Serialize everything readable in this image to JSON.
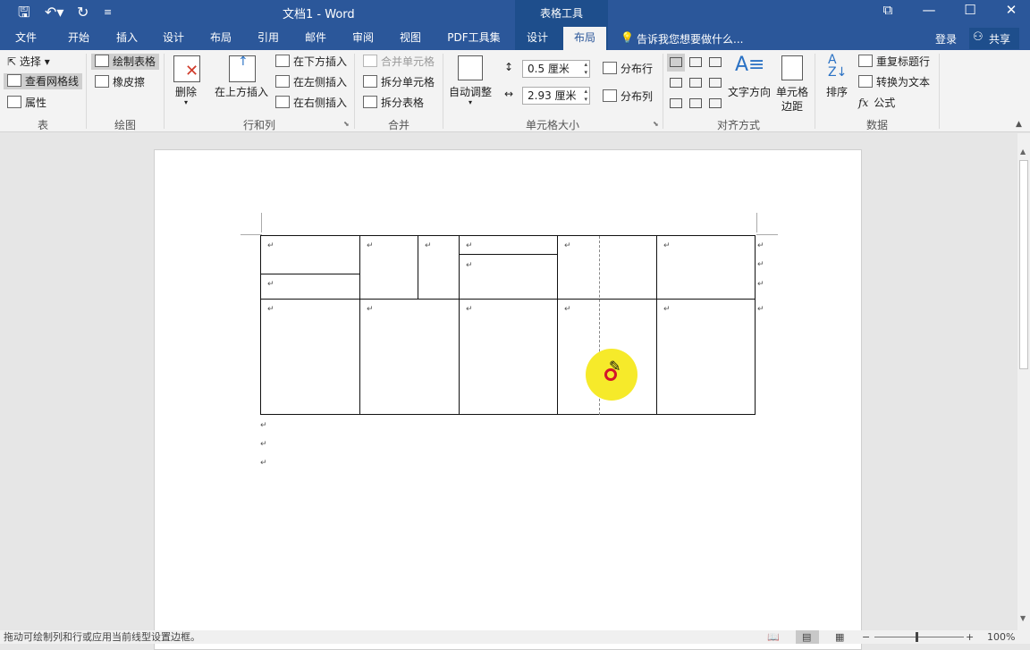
{
  "title_bar": {
    "doc_title": "文档1 - Word",
    "context_group": "表格工具",
    "window_buttons": [
      "restore-ribbon-icon",
      "minimize-icon",
      "maximize-icon",
      "close-icon"
    ]
  },
  "quick_access": {
    "icons": [
      "save-icon",
      "undo-icon",
      "redo-icon",
      "customize-icon"
    ]
  },
  "tabs": [
    "文件",
    "开始",
    "插入",
    "设计",
    "布局",
    "引用",
    "邮件",
    "审阅",
    "视图",
    "PDF工具集",
    "设计",
    "布局"
  ],
  "active_tab": "布局",
  "tell_me": "告诉我您想要做什么...",
  "account": {
    "login": "登录",
    "share": "共享"
  },
  "ribbon": {
    "table": {
      "select": "选择",
      "gridlines": "查看网格线",
      "properties": "属性",
      "label": "表"
    },
    "draw": {
      "draw_table": "绘制表格",
      "eraser": "橡皮擦",
      "label": "绘图"
    },
    "rows_cols": {
      "delete": "删除",
      "insert_above": "在上方插入",
      "insert_below": "在下方插入",
      "insert_left": "在左侧插入",
      "insert_right": "在右侧插入",
      "label": "行和列"
    },
    "merge": {
      "merge_cells": "合并单元格",
      "split_cells": "拆分单元格",
      "split_table": "拆分表格",
      "label": "合并"
    },
    "cell_size": {
      "autofit": "自动调整",
      "height": "0.5 厘米",
      "width": "2.93 厘米",
      "distribute_rows": "分布行",
      "distribute_cols": "分布列",
      "label": "单元格大小"
    },
    "alignment": {
      "text_direction": "文字方向",
      "cell_margins_1": "单元格",
      "cell_margins_2": "边距",
      "label": "对齐方式"
    },
    "data": {
      "sort": "排序",
      "repeat_header": "重复标题行",
      "convert_text": "转换为文本",
      "formula": "公式",
      "label": "数据"
    }
  },
  "document": {
    "paragraph_mark": "↵"
  },
  "status_bar": {
    "hint": "拖动可绘制列和行或应用当前线型设置边框。",
    "zoom": "100%"
  }
}
